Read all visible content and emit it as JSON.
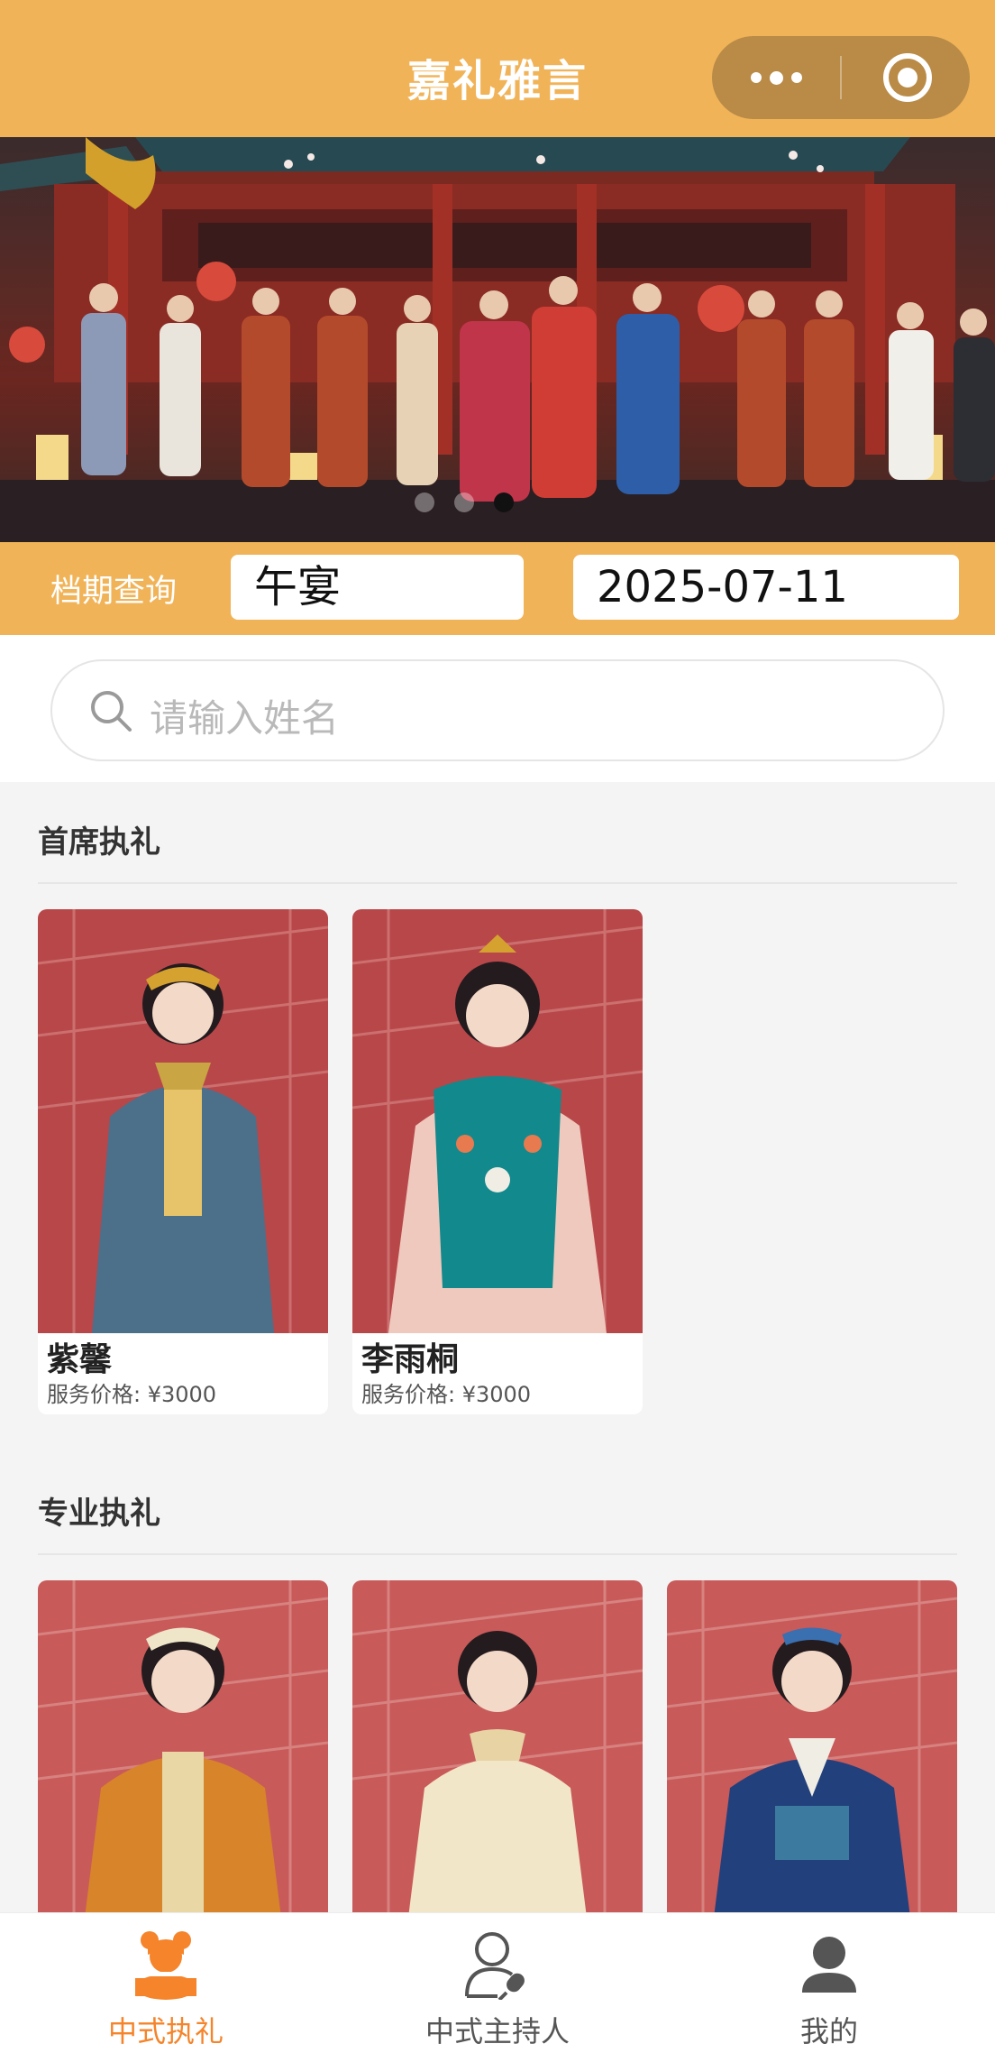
{
  "header": {
    "title": "嘉礼雅言",
    "more_icon": "more-dots-icon",
    "close_icon": "target-close-icon"
  },
  "banner": {
    "slide_count": 3,
    "active_slide": 3
  },
  "schedule": {
    "label": "档期查询",
    "meal": "午宴",
    "date": "2025-07-11"
  },
  "search": {
    "placeholder": "请输入姓名"
  },
  "sections": [
    {
      "title": "首席执礼",
      "cards": [
        {
          "name": "紫馨",
          "price": "服务价格: ¥3000"
        },
        {
          "name": "李雨桐",
          "price": "服务价格: ¥3000"
        }
      ]
    },
    {
      "title": "专业执礼",
      "cards": [
        {
          "name": "",
          "price": ""
        },
        {
          "name": "",
          "price": ""
        },
        {
          "name": "",
          "price": ""
        }
      ]
    }
  ],
  "tabbar": {
    "items": [
      {
        "label": "中式执礼",
        "icon": "bride-icon",
        "active": true
      },
      {
        "label": "中式主持人",
        "icon": "host-microphone-icon",
        "active": false
      },
      {
        "label": "我的",
        "icon": "user-profile-icon",
        "active": false
      }
    ]
  },
  "colors": {
    "brand": "#f1b358",
    "capsule": "#b98b47",
    "active_tab": "#f5842a",
    "background": "#f4f4f5"
  }
}
